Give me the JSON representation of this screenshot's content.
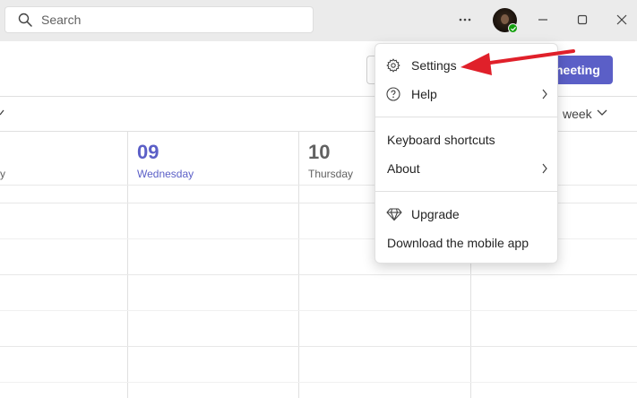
{
  "search": {
    "placeholder": "Search"
  },
  "title_bar": {
    "more_label": "···"
  },
  "toolbar": {
    "meeting_label": "neeting"
  },
  "view": {
    "label": "week"
  },
  "days": [
    {
      "fragment": "y"
    },
    {
      "number": "09",
      "name": "Wednesday"
    },
    {
      "number": "10",
      "name": "Thursday"
    }
  ],
  "menu": {
    "items": [
      {
        "label": "Settings",
        "icon": "gear-icon"
      },
      {
        "label": "Help",
        "icon": "question-circle-icon",
        "has_submenu": true
      },
      {
        "label": "Keyboard shortcuts"
      },
      {
        "label": "About",
        "has_submenu": true
      },
      {
        "label": "Upgrade",
        "icon": "diamond-icon"
      },
      {
        "label": "Download the mobile app"
      }
    ]
  },
  "colors": {
    "accent": "#5b5fc7",
    "presence_available": "#13a10e",
    "annotation_arrow": "#e0202a",
    "titlebar_bg": "#ebebeb"
  }
}
